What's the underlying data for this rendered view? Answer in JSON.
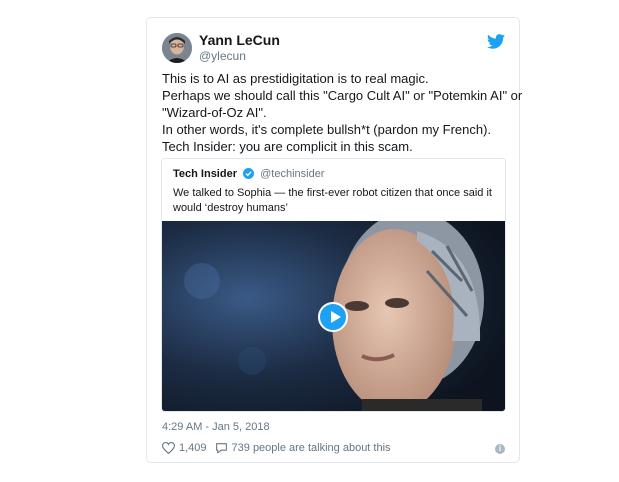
{
  "tweet": {
    "author_name": "Yann LeCun",
    "author_handle": "@ylecun",
    "text_lines": [
      "This is to AI as prestidigitation is to real magic.",
      "Perhaps we should call this \"Cargo Cult AI\" or \"Potemkin AI\" or",
      "\"Wizard-of-Oz AI\".",
      "In other words, it's complete bullsh*t (pardon my French).",
      "Tech Insider: you are complicit in this scam."
    ],
    "timestamp": "4:29 AM - Jan 5, 2018",
    "likes": "1,409",
    "conversation": "739 people are talking about this"
  },
  "quoted": {
    "name": "Tech Insider",
    "handle": "@techinsider",
    "text": "We talked to Sophia — the first-ever robot citizen that once said it would ‘destroy humans’"
  },
  "icons": {
    "twitter": "twitter-bird-icon",
    "verified": "verified-badge-icon",
    "play": "play-icon",
    "like": "heart-icon",
    "reply": "speech-bubble-icon",
    "info": "info-icon"
  },
  "colors": {
    "accent": "#1da1f2",
    "muted": "#657786",
    "border": "#e1e8ed"
  }
}
